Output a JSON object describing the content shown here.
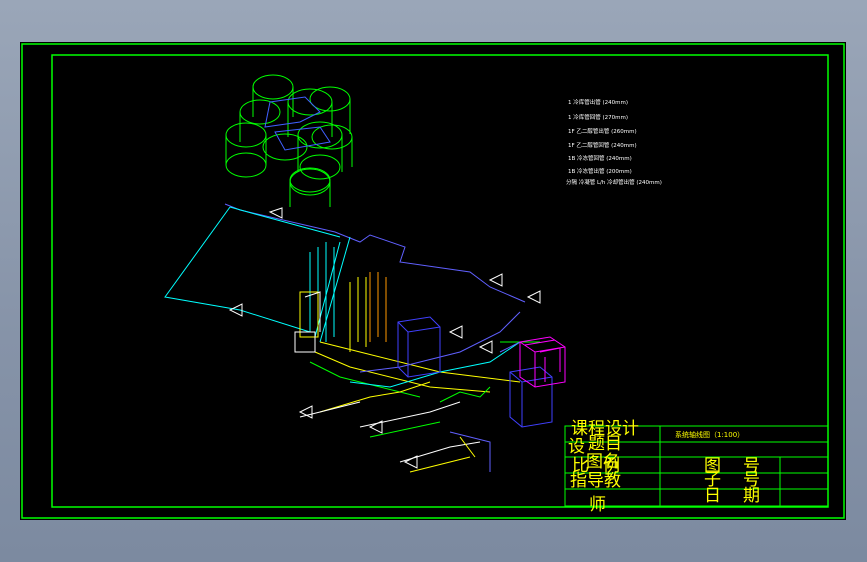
{
  "notes": [
    "1  冷库管出管 (240mm)",
    "1  冷库管回管 (270mm)",
    "1F 乙二醇管出管 (260mm)",
    "1F 乙二醇管回管 (240mm)",
    "1B 冷冻管回管 (240mm)",
    "1B 冷冻管出管 (200mm)",
    "分隔 冷凝管 L/h 冷却管出管 (240mm)"
  ],
  "title_block": {
    "drawing_title": "系统轴线图（1:100）",
    "course_design": "课程设计",
    "design_label": "设",
    "title_label": "题目",
    "drawing_name": "图名",
    "scale": "比例",
    "advisor": "指导教",
    "teacher": "师",
    "drawing_no": "图号",
    "sheet_no": "子号",
    "date": "日期"
  },
  "colors": {
    "background": "#000000",
    "frame": "#00ff00",
    "title_text": "#ffff00",
    "pipe_cyan": "#00ffff",
    "pipe_blue": "#4040ff",
    "pipe_yellow": "#ffff00",
    "pipe_green": "#00ff00",
    "tank_magenta": "#ff00ff",
    "riser_orange": "#ff9900"
  }
}
